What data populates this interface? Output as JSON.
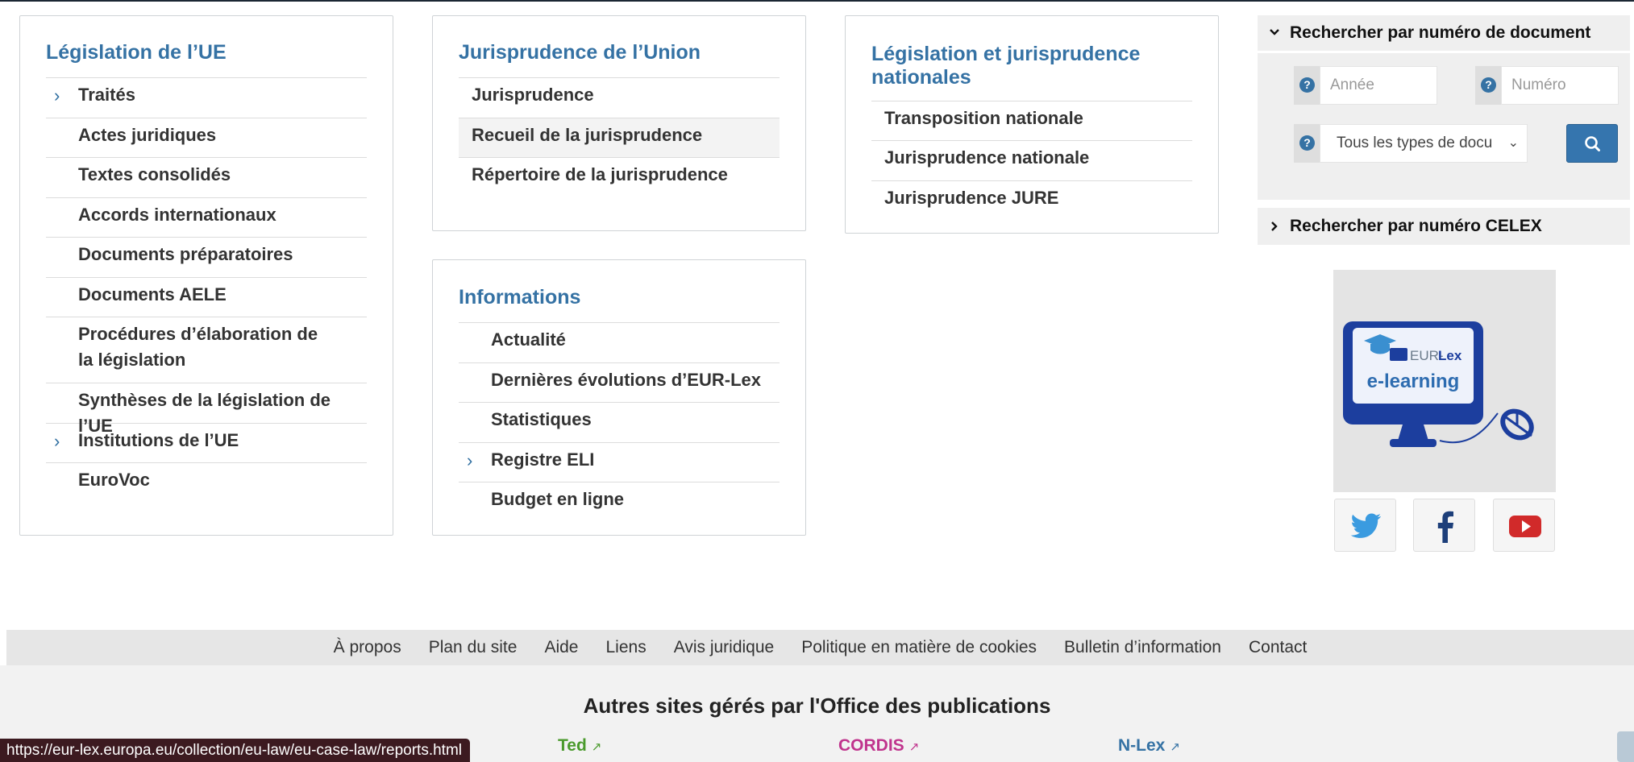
{
  "legislation": {
    "title": "Législation de l’UE",
    "items": [
      "Traités",
      "Actes juridiques",
      "Textes consolidés",
      "Accords internationaux",
      "Documents préparatoires",
      "Documents AELE",
      "Procédures d’élaboration de la législation",
      "Synthèses de la législation de l’UE",
      "Institutions de l’UE",
      "EuroVoc"
    ]
  },
  "caselaw": {
    "title": "Jurisprudence de l’Union",
    "items": [
      "Jurisprudence",
      "Recueil de la jurisprudence",
      "Répertoire de la jurisprudence"
    ]
  },
  "national": {
    "title": "Législation et jurisprudence nationales",
    "items": [
      "Transposition nationale",
      "Jurisprudence nationale",
      "Jurisprudence JURE"
    ]
  },
  "info": {
    "title": "Informations",
    "items": [
      "Actualité",
      "Dernières évolutions d’EUR-Lex",
      "Statistiques",
      "Registre ELI",
      "Budget en ligne"
    ]
  },
  "search": {
    "doc_heading": "Rechercher par numéro de document",
    "year_placeholder": "Année",
    "number_placeholder": "Numéro",
    "type_selected": "Tous les types de docu",
    "celex_heading": "Rechercher par numéro CELEX"
  },
  "elearning": {
    "brand": "EUR-Lex",
    "brand_prefix": "EUR-",
    "brand_suffix": "Lex",
    "label": "e-learning"
  },
  "social": {
    "icons": [
      "twitter-icon",
      "facebook-icon",
      "youtube-icon"
    ]
  },
  "footer": {
    "links": [
      "À propos",
      "Plan du site",
      "Aide",
      "Liens",
      "Avis juridique",
      "Politique en matière de cookies",
      "Bulletin d’information",
      "Contact"
    ],
    "other_sites_title": "Autres sites gérés par l'Office des publications",
    "sites": [
      {
        "name": "Ted",
        "color": "#4a9a2c"
      },
      {
        "name": "CORDIS",
        "color": "#c0348d"
      },
      {
        "name": "N-Lex",
        "color": "#3572a4"
      }
    ]
  },
  "status_url": "https://eur-lex.europa.eu/collection/eu-law/eu-case-law/reports.html",
  "colors": {
    "accent": "#3572a4",
    "button": "#3575ae",
    "elearning_navy": "#1c3e9e"
  }
}
